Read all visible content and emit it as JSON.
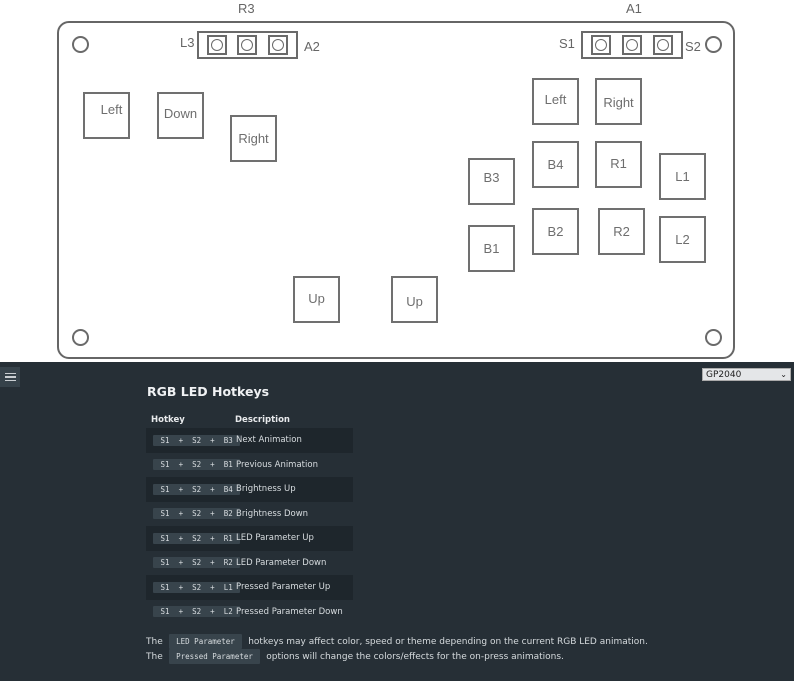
{
  "diagram": {
    "top_labels": {
      "r3": "R3",
      "a1": "A1"
    },
    "aux_labels": {
      "l3": "L3",
      "a2": "A2",
      "s1": "S1",
      "s2": "S2"
    },
    "buttons": {
      "left_left": "Left",
      "left_down": "Down",
      "left_right": "Right",
      "up1": "Up",
      "up2": "Up",
      "right_left": "Left",
      "right_right": "Right",
      "b3": "B3",
      "b4": "B4",
      "r1": "R1",
      "l1": "L1",
      "b1": "B1",
      "b2": "B2",
      "r2": "R2",
      "l2": "L2"
    }
  },
  "panel": {
    "board_select": {
      "value": "GP2040"
    },
    "title": "RGB LED Hotkeys",
    "table": {
      "headers": [
        "Hotkey",
        "Description"
      ],
      "rows": [
        {
          "hotkey": "S1 + S2 + B3",
          "description": "Next Animation"
        },
        {
          "hotkey": "S1 + S2 + B1",
          "description": "Previous Animation"
        },
        {
          "hotkey": "S1 + S2 + B4",
          "description": "Brightness Up"
        },
        {
          "hotkey": "S1 + S2 + B2",
          "description": "Brightness Down"
        },
        {
          "hotkey": "S1 + S2 + R1",
          "description": "LED Parameter Up"
        },
        {
          "hotkey": "S1 + S2 + R2",
          "description": "LED Parameter Down"
        },
        {
          "hotkey": "S1 + S2 + L1",
          "description": "Pressed Parameter Up"
        },
        {
          "hotkey": "S1 + S2 + L2",
          "description": "Pressed Parameter Down"
        }
      ]
    },
    "notes": [
      {
        "prefix": "The",
        "code": "LED Parameter",
        "suffix": "hotkeys may affect color, speed or theme depending on the current RGB LED animation."
      },
      {
        "prefix": "The",
        "code": "Pressed Parameter",
        "suffix": "options will change the colors/effects for the on-press animations."
      }
    ]
  }
}
